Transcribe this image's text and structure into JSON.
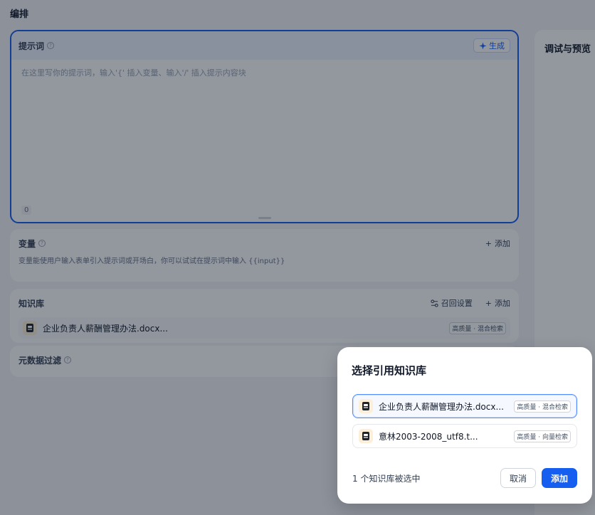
{
  "page": {
    "title": "编排"
  },
  "prompt": {
    "title": "提示词",
    "generate_label": "生成",
    "placeholder": "在这里写你的提示词，输入'{' 插入变量、输入'/' 插入提示内容块",
    "char_count": "0"
  },
  "variables": {
    "title": "变量",
    "add_label": "添加",
    "description": "变量能使用户输入表单引入提示词或开场白，你可以试试在提示词中输入 {{input}}"
  },
  "knowledge": {
    "title": "知识库",
    "recall_label": "召回设置",
    "add_label": "添加",
    "items": [
      {
        "name": "企业负责人薪酬管理办法.docx...",
        "badge": "高质量 · 混合检索"
      }
    ]
  },
  "metadata_filter": {
    "title": "元数据过滤"
  },
  "debug": {
    "title": "调试与预览"
  },
  "modal": {
    "title": "选择引用知识库",
    "items": [
      {
        "name": "企业负责人薪酬管理办法.docx...",
        "badge": "高质量 · 混合检索",
        "selected": true
      },
      {
        "name": "意林2003-2008_utf8.t...",
        "badge": "高质量 · 向量检索",
        "selected": false
      }
    ],
    "selected_count": "1 个知识库被选中",
    "cancel_label": "取消",
    "add_label": "添加"
  },
  "colors": {
    "accent": "#155eef",
    "selected_border": "#528bff"
  }
}
